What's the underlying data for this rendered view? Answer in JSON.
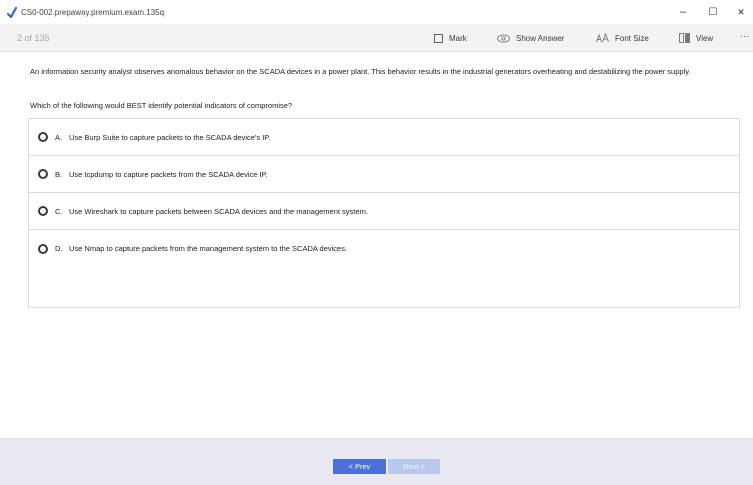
{
  "window": {
    "title": "CS0-002.prepaway.premium.exam.135q",
    "minimize_glyph": "–",
    "maximize_glyph": "☐",
    "close_glyph": "✕"
  },
  "toolbar": {
    "counter": "2 of 135",
    "mark_label": "Mark",
    "show_answer_label": "Show Answer",
    "font_size_label": "Font Size",
    "view_label": "View",
    "more_glyph": "···"
  },
  "question": {
    "stem": "An information security analyst observes anomalous behavior on the SCADA devices in a power plant. This behavior results in the industrial generators overheating and destabilizing the power supply.",
    "prompt": "Which of the following would BEST identify potential indicators of compromise?"
  },
  "answers": [
    {
      "letter": "A.",
      "text": "Use Burp Suite to capture packets to the SCADA device's IP."
    },
    {
      "letter": "B.",
      "text": "Use tcpdump to capture packets from the SCADA device IP."
    },
    {
      "letter": "C.",
      "text": "Use Wireshark to capture packets between SCADA devices and the management system."
    },
    {
      "letter": "D.",
      "text": "Use Nmap to capture packets from the management system to the SCADA devices."
    }
  ],
  "footer": {
    "prev_label": "<  Prev",
    "next_label": "Next  >"
  },
  "colors": {
    "accent_blue": "#4b70d6",
    "disabled_blue": "#b9c8ee",
    "toolbar_bg": "#f3f3f3",
    "footer_bg": "#e9e9f2",
    "app_icon_blue": "#1f6fd1"
  },
  "icons": [
    "app-icon",
    "mark-icon",
    "show-answer-icon",
    "font-size-icon",
    "view-icon"
  ]
}
